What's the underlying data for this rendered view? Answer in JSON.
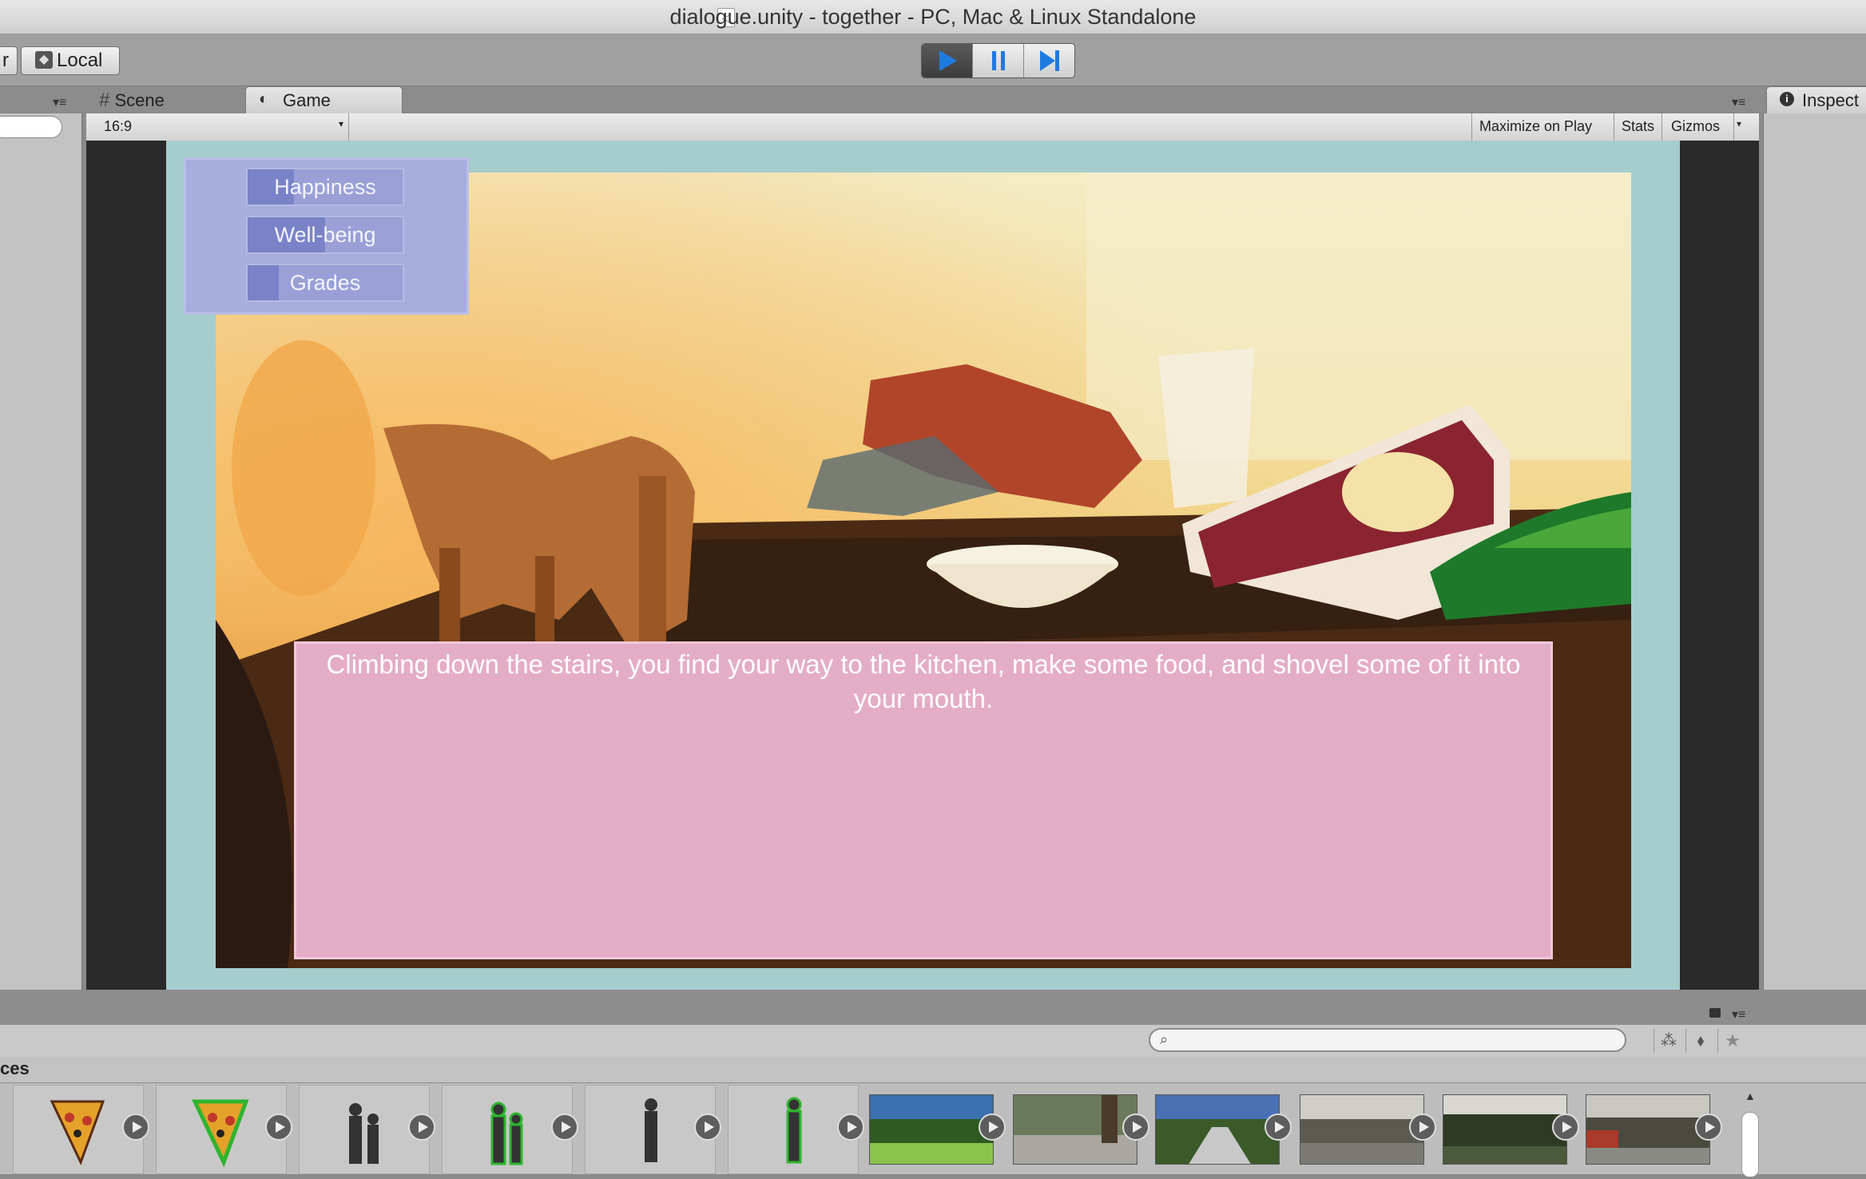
{
  "window": {
    "title": "dialogue.unity - together - PC, Mac & Linux Standalone"
  },
  "toolbar": {
    "left_stub_label": "r",
    "local_label": "Local",
    "play_icon": "play-icon",
    "pause_icon": "pause-icon",
    "step_icon": "step-icon"
  },
  "tabs": {
    "scene": "Scene",
    "game": "Game",
    "inspector": "Inspect"
  },
  "game_bar": {
    "aspect": "16:9",
    "maximize": "Maximize on Play",
    "stats": "Stats",
    "gizmos": "Gizmos"
  },
  "game": {
    "stats": [
      {
        "label": "Happiness",
        "fill": 0.3
      },
      {
        "label": "Well-being",
        "fill": 0.5
      },
      {
        "label": "Grades",
        "fill": 0.2
      }
    ],
    "dialogue": "Climbing down the stairs, you find your way to the kitchen, make some food, and shovel some of it into your mouth."
  },
  "project": {
    "breadcrumb": "ces",
    "assets": [
      {
        "icon": "pizza-character-icon"
      },
      {
        "icon": "pizza-character-green-outline-icon"
      },
      {
        "icon": "family-silhouette-icon"
      },
      {
        "icon": "family-silhouette-green-outline-icon"
      },
      {
        "icon": "person-silhouette-icon"
      },
      {
        "icon": "person-silhouette-green-outline-icon"
      },
      {
        "icon": "park-photo-thumbnail"
      },
      {
        "icon": "path-photo-thumbnail"
      },
      {
        "icon": "sidewalk-photo-thumbnail"
      },
      {
        "icon": "street-photo-thumbnail"
      },
      {
        "icon": "garden-photo-thumbnail"
      },
      {
        "icon": "road-photo-thumbnail"
      }
    ]
  },
  "colors": {
    "game_background": "#a6cdcd",
    "stats_panel": "#a7aede",
    "dialogue_box": "#e4adc6",
    "play_active": "#1f7ae0"
  }
}
